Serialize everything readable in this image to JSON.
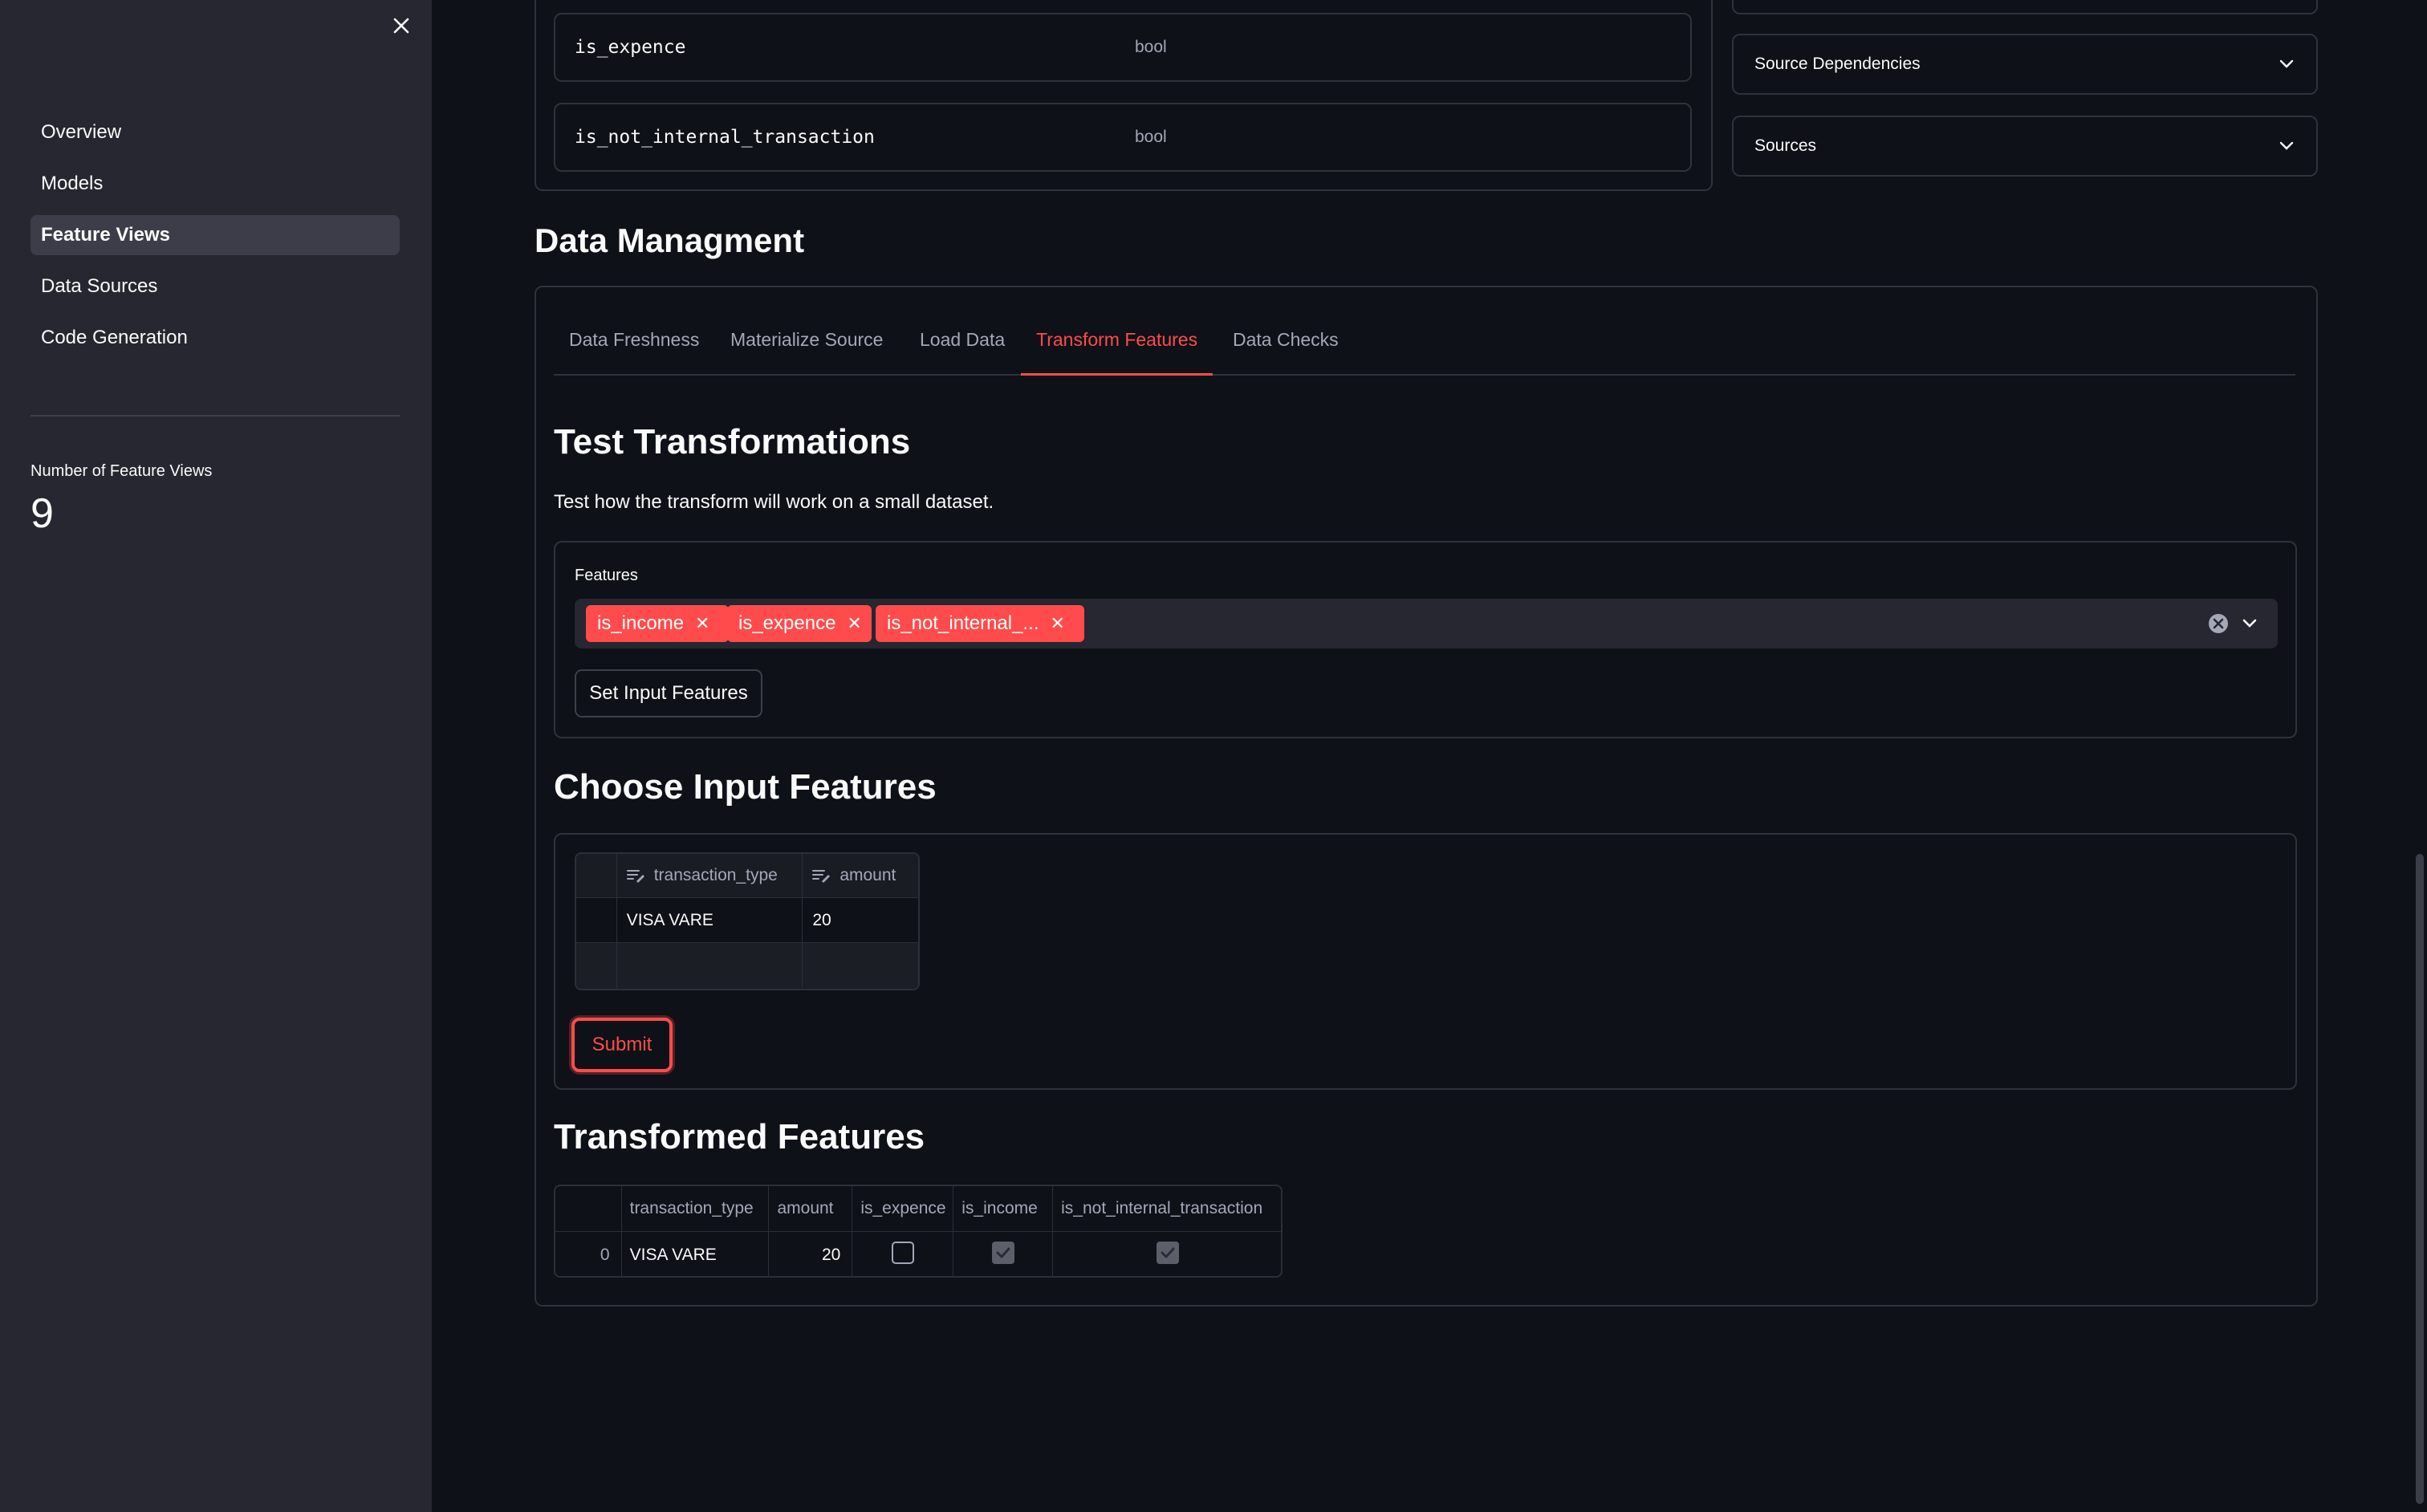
{
  "sidebar": {
    "nav": [
      {
        "label": "Overview",
        "active": false
      },
      {
        "label": "Models",
        "active": false
      },
      {
        "label": "Feature Views",
        "active": true
      },
      {
        "label": "Data Sources",
        "active": false
      },
      {
        "label": "Code Generation",
        "active": false
      }
    ],
    "metric": {
      "label": "Number of Feature Views",
      "value": "9"
    }
  },
  "schema_rows": [
    {
      "name": "is_expence",
      "type": "bool"
    },
    {
      "name": "is_not_internal_transaction",
      "type": "bool"
    }
  ],
  "expanders": [
    {
      "label": "Source Dependencies"
    },
    {
      "label": "Sources"
    }
  ],
  "data_management": {
    "title": "Data Managment",
    "tabs": [
      {
        "label": "Data Freshness",
        "active": false
      },
      {
        "label": "Materialize Source",
        "active": false
      },
      {
        "label": "Load Data",
        "active": false
      },
      {
        "label": "Transform Features",
        "active": true
      },
      {
        "label": "Data Checks",
        "active": false
      }
    ]
  },
  "test_transformations": {
    "title": "Test Transformations",
    "description": "Test how the transform will work on a small dataset.",
    "features_label": "Features",
    "selected": [
      "is_income",
      "is_expence",
      "is_not_internal_..."
    ],
    "set_button": "Set Input Features"
  },
  "choose_input": {
    "title": "Choose Input Features",
    "columns": [
      "transaction_type",
      "amount"
    ],
    "rows": [
      [
        "VISA VARE",
        "20"
      ]
    ],
    "submit": "Submit"
  },
  "transformed": {
    "title": "Transformed Features",
    "columns": [
      "transaction_type",
      "amount",
      "is_expence",
      "is_income",
      "is_not_internal_transaction"
    ],
    "rows": [
      {
        "index": "0",
        "transaction_type": "VISA VARE",
        "amount": "20",
        "is_expence": false,
        "is_income": true,
        "is_not_internal_transaction": true
      }
    ]
  },
  "colors": {
    "accent": "#ff4b4b",
    "background": "#0e1117",
    "sidebar": "#262730"
  }
}
